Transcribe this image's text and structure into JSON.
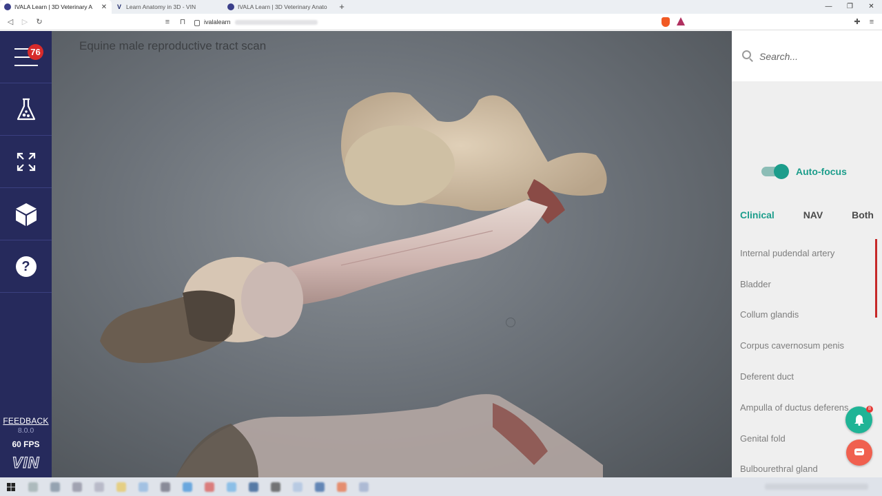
{
  "browser": {
    "tabs": [
      {
        "title": "IVALA Learn | 3D Veterinary A",
        "active": true,
        "icon": "ivala-favicon"
      },
      {
        "title": "Learn Anatomy in 3D - VIN",
        "active": false,
        "icon": "vin-favicon"
      },
      {
        "title": "IVALA Learn | 3D Veterinary Anato",
        "active": false,
        "icon": "ivala-favicon"
      }
    ],
    "new_tab": "+",
    "url": "ivalalearn"
  },
  "sidebar": {
    "badge_count": "76",
    "icons": [
      "hamburger-menu-icon",
      "lab-flask-icon",
      "fullscreen-expand-icon",
      "cube-3d-icon",
      "help-icon"
    ],
    "feedback": "FEEDBACK",
    "version": "8.0.0",
    "fps": "60 FPS",
    "logo": "VIN"
  },
  "viewer": {
    "title": "Equine male reproductive tract scan"
  },
  "panel": {
    "search_placeholder": "Search...",
    "autofocus_label": "Auto-focus",
    "autofocus_on": true,
    "tabs": [
      {
        "label": "Clinical",
        "active": true
      },
      {
        "label": "NAV",
        "active": false
      },
      {
        "label": "Both",
        "active": false
      }
    ],
    "structures": [
      "Internal pudendal artery",
      "Bladder",
      "Collum glandis",
      "Corpus cavernosum penis",
      "Deferent duct",
      "Ampulla of ductus deferens",
      "Genital fold",
      "Bulbourethral gland"
    ],
    "notification_count": "8"
  },
  "colors": {
    "sidebar": "#262a5c",
    "accent": "#1c9d8b",
    "badge": "#d72b2b",
    "chat": "#f0604f"
  }
}
